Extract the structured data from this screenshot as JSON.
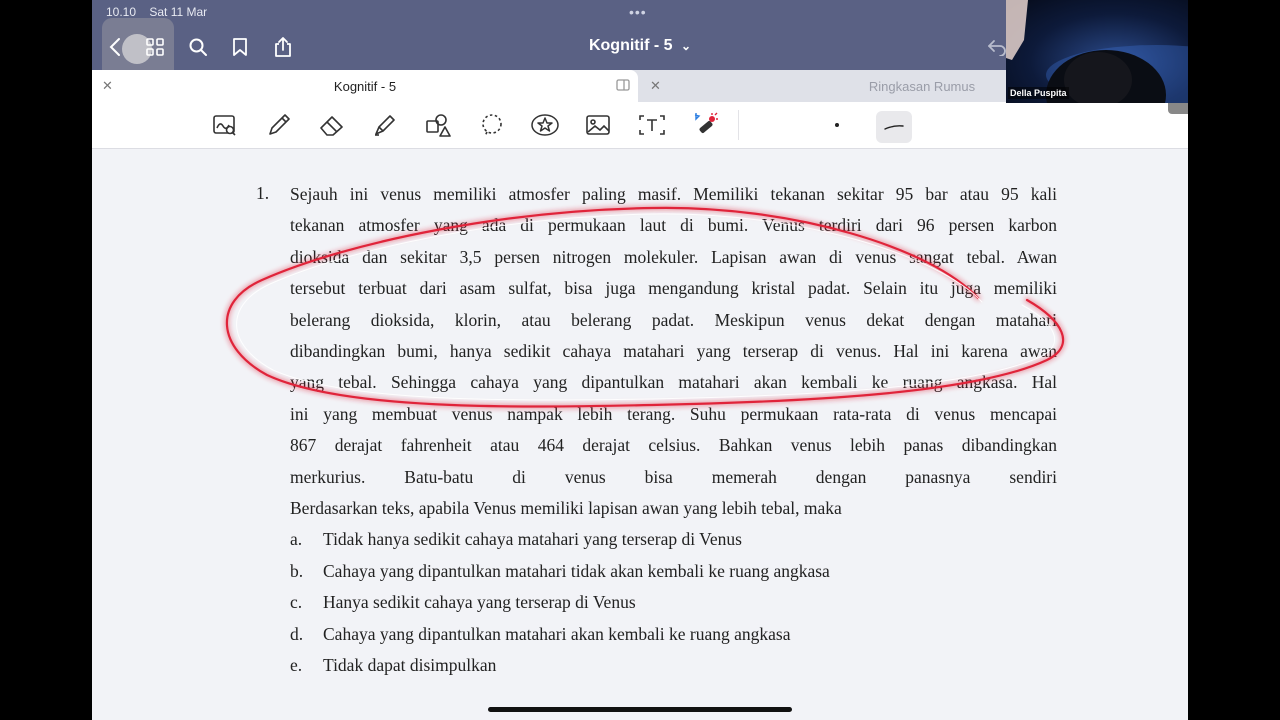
{
  "status_bar": {
    "time": "10.10",
    "date": "Sat 11 Mar"
  },
  "app": {
    "document_title": "Kognitif - 5",
    "title_caret": "⌄"
  },
  "tabs": [
    {
      "label": "Kognitif - 5",
      "active": true
    },
    {
      "label": "Ringkasan Rumus",
      "active": false
    }
  ],
  "toolbar": {
    "tools": [
      "zoom-lasso",
      "pen",
      "eraser",
      "highlighter",
      "shapes",
      "lasso",
      "sticker",
      "image",
      "text",
      "laser-pointer"
    ],
    "accent_color": "#2a7de1"
  },
  "webcam": {
    "name": "Della Puspita"
  },
  "question": {
    "number": "1.",
    "lines": [
      "Sejauh ini venus memiliki atmosfer paling masif. Memiliki tekanan sekitar 95 bar atau 95 kali",
      "tekanan atmosfer yang ada di permukaan laut di bumi. Venus terdiri dari 96 persen karbon",
      "dioksida dan sekitar 3,5 persen nitrogen molekuler. Lapisan awan di venus sangat tebal. Awan",
      "tersebut terbuat dari asam sulfat, bisa juga mengandung kristal padat. Selain itu juga memiliki",
      "belerang dioksida, klorin, atau belerang padat. Meskipun venus dekat dengan matahari",
      "dibandingkan bumi, hanya sedikit cahaya matahari yang terserap di venus. Hal ini karena awan",
      "yang tebal. Sehingga cahaya yang dipantulkan matahari akan kembali ke ruang angkasa. Hal",
      "ini yang membuat venus nampak lebih terang. Suhu permukaan rata-rata di venus mencapai",
      "867 derajat fahrenheit atau 464 derajat celsius. Bahkan venus lebih panas dibandingkan",
      "merkurius. Batu-batu di venus bisa memerah dengan panasnya sendiri",
      "Berdasarkan teks, apabila Venus memiliki lapisan awan yang lebih tebal, maka"
    ],
    "options": [
      {
        "letter": "a.",
        "text": "Tidak hanya sedikit cahaya matahari yang terserap di Venus"
      },
      {
        "letter": "b.",
        "text": "Cahaya yang dipantulkan matahari tidak akan kembali ke ruang angkasa"
      },
      {
        "letter": "c.",
        "text": "Hanya sedikit cahaya yang terserap di Venus"
      },
      {
        "letter": "d.",
        "text": "Cahaya yang dipantulkan matahari akan kembali ke ruang angkasa"
      },
      {
        "letter": "e.",
        "text": "Tidak dapat disimpulkan"
      }
    ]
  },
  "annotation": {
    "color": "#e0243a"
  }
}
